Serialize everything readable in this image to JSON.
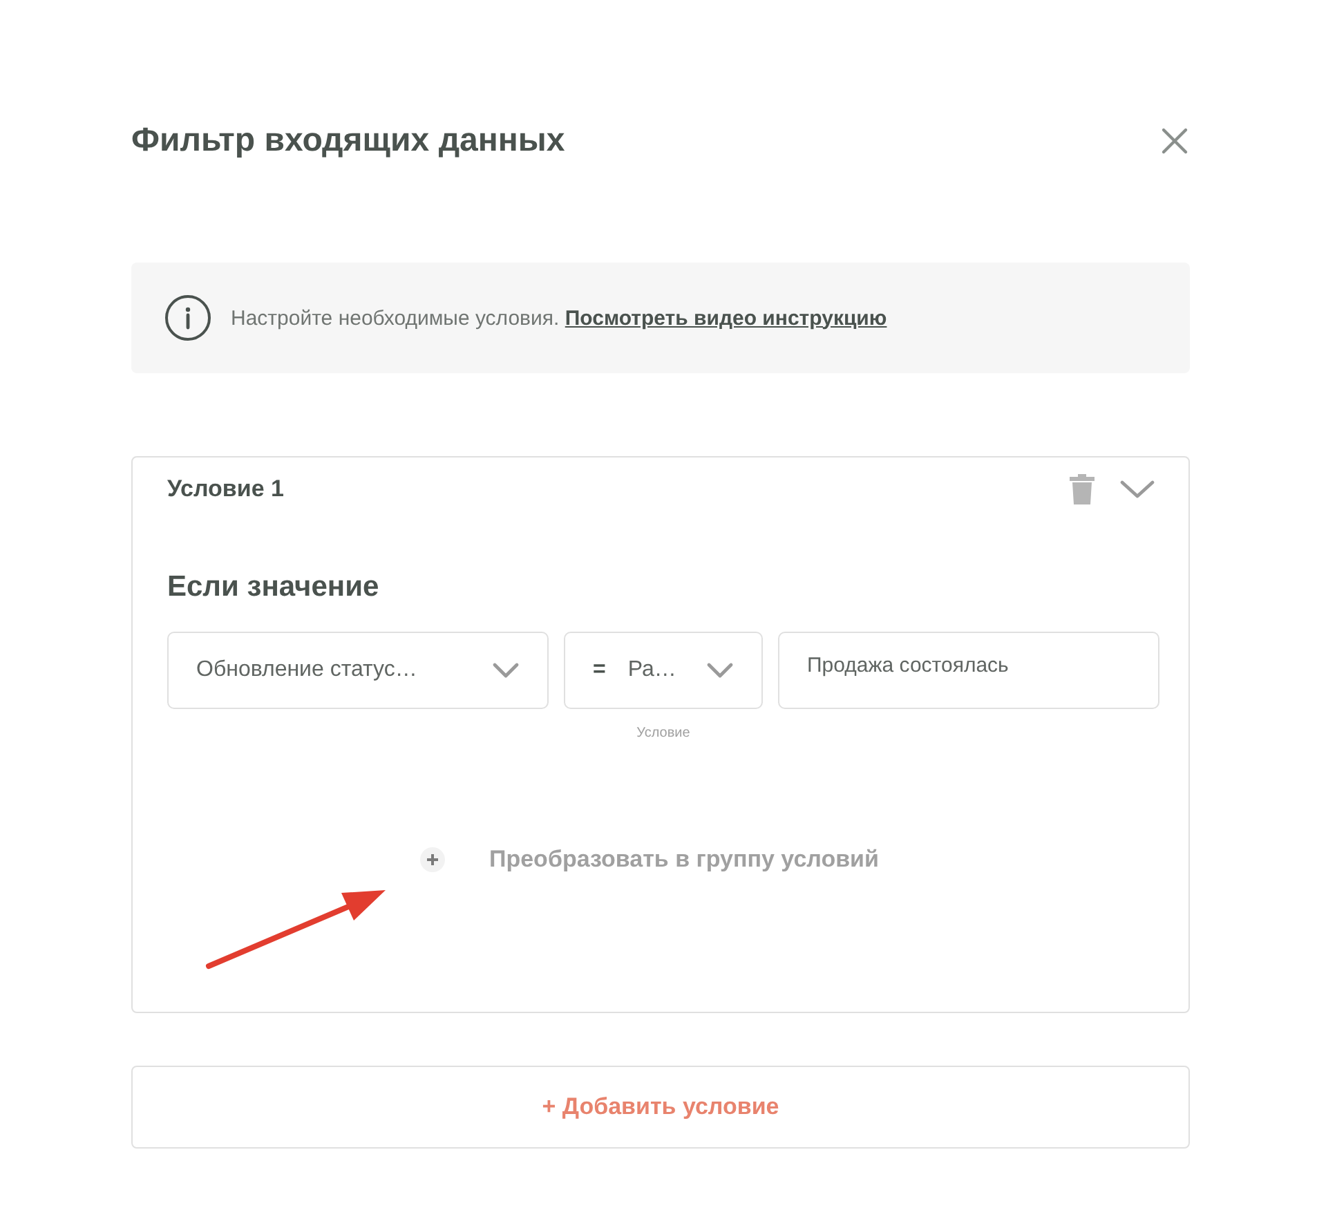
{
  "dialog": {
    "title": "Фильтр входящих данных"
  },
  "info": {
    "text": "Настройте необходимые условия.",
    "link": "Посмотреть видео инструкцию"
  },
  "conditions": [
    {
      "title": "Условие 1",
      "expanded": true,
      "heading": "Если значение",
      "fields": [
        {
          "kind": "select",
          "value": "Обновление статус…"
        },
        {
          "kind": "select",
          "prefix": "=",
          "value": "Ра…",
          "caption": "Условие"
        },
        {
          "kind": "input",
          "value": "Продажа состоялась"
        }
      ],
      "convert_action": "Преобразовать в группу условий"
    }
  ],
  "add_button": "+ Добавить условие"
}
